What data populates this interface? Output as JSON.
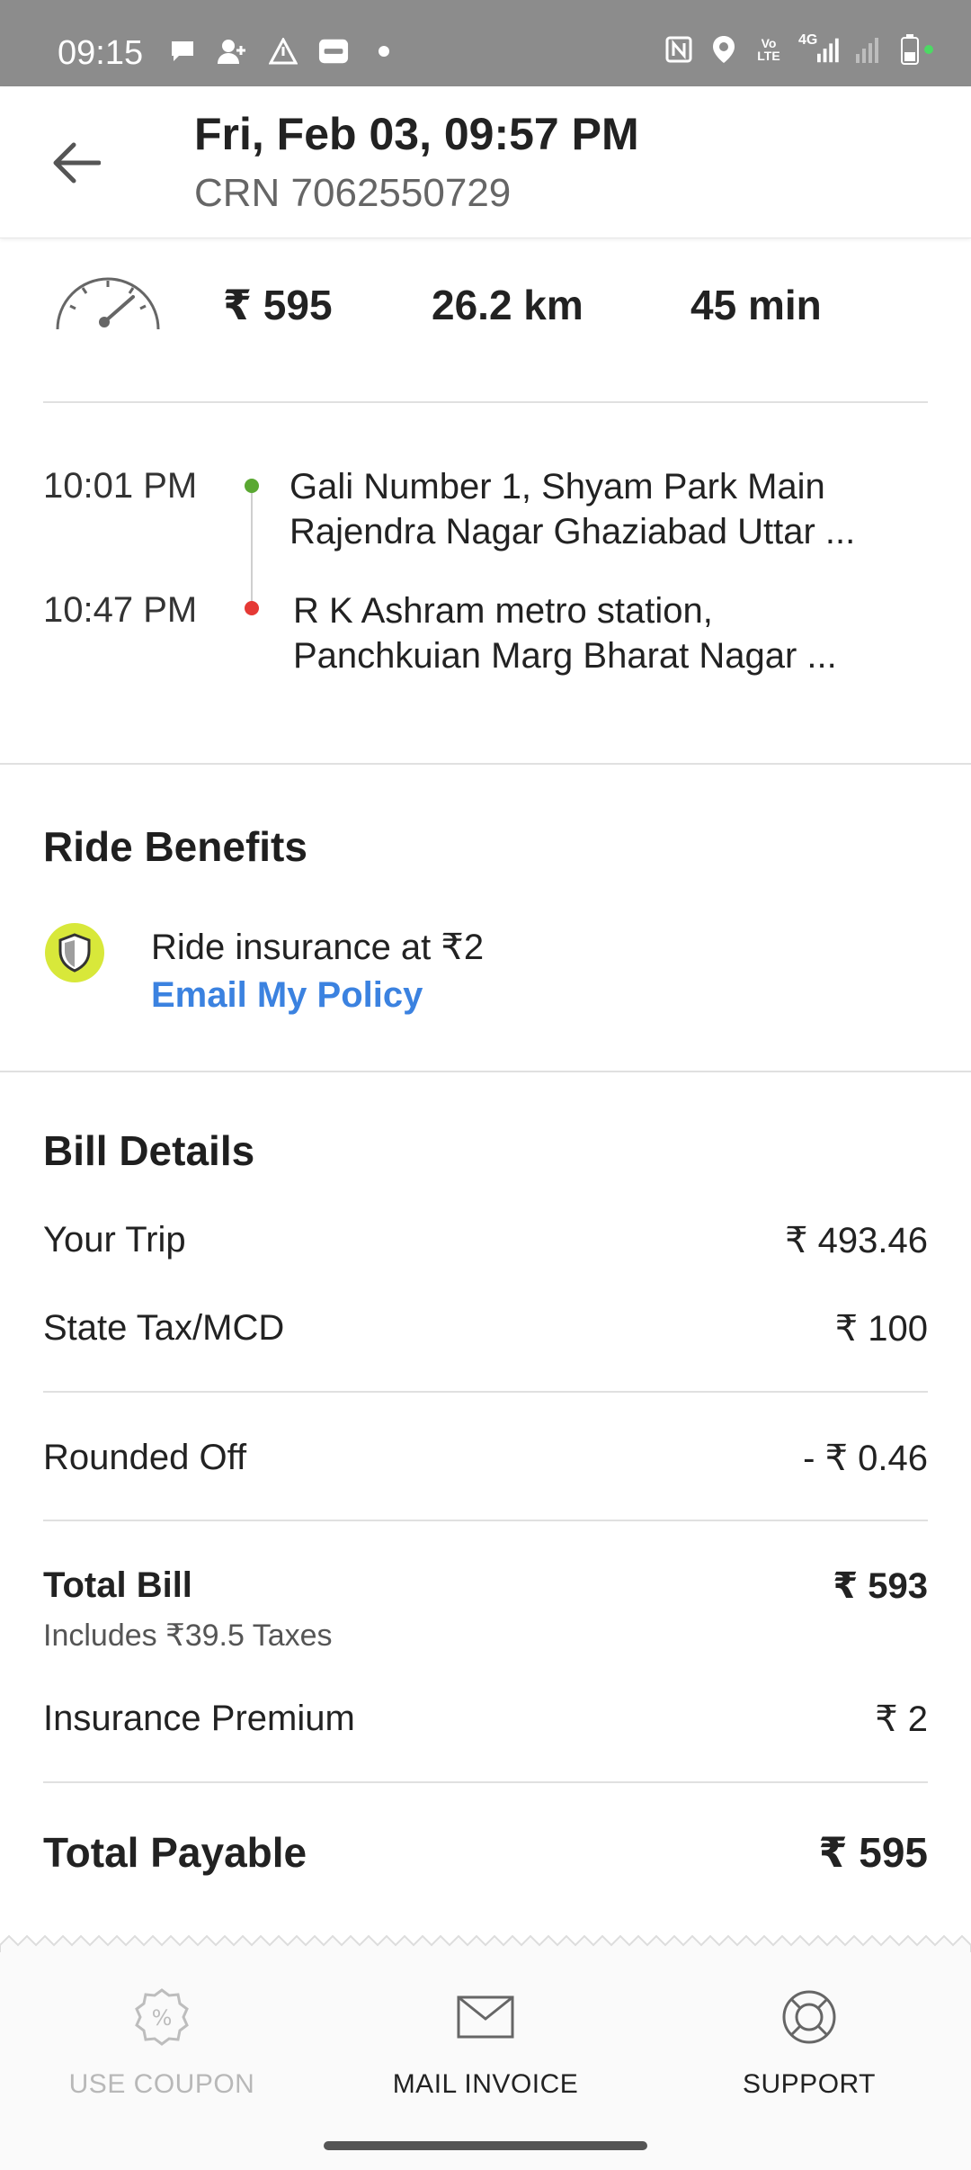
{
  "status_bar": {
    "time": "09:15",
    "network_label": "4G",
    "volte_label": "Vo LTE",
    "left_icons": [
      "chat-bubble-icon",
      "add-person-icon",
      "warning-triangle-icon",
      "paytm-icon",
      "dot-icon"
    ],
    "right_icons": [
      "nfc-icon",
      "location-icon",
      "volte-icon",
      "signal-4g-icon",
      "signal-icon",
      "battery-icon"
    ]
  },
  "header": {
    "title": "Fri, Feb 03, 09:57 PM",
    "crn": "CRN 7062550729",
    "back_icon": "arrow-left-icon"
  },
  "summary": {
    "fare": "₹ 595",
    "distance": "26.2 km",
    "duration": "45 min",
    "icon": "speedometer-icon"
  },
  "route": {
    "pickup": {
      "time": "10:01 PM",
      "address_line1": "Gali Number 1, Shyam Park Main",
      "address_line2": "Rajendra Nagar Ghaziabad Uttar ...",
      "pin_color": "#5aa832"
    },
    "drop": {
      "time": "10:47 PM",
      "address_line1": "R K Ashram metro station,",
      "address_line2": "Panchkuian Marg Bharat Nagar ...",
      "pin_color": "#e53935"
    }
  },
  "ride_benefits": {
    "title": "Ride Benefits",
    "insurance_text": "Ride insurance at ₹2",
    "email_link": "Email My Policy",
    "icon": "shield-icon",
    "accent": "#3b82e0"
  },
  "bill": {
    "title": "Bill Details",
    "rows": [
      {
        "label": "Your Trip",
        "value": "₹ 493.46"
      },
      {
        "label": "State Tax/MCD",
        "value": "₹ 100"
      },
      {
        "label": "Rounded Off",
        "value": "- ₹ 0.46"
      }
    ],
    "total_bill_label": "Total Bill",
    "total_bill_value": "₹ 593",
    "total_bill_note": "Includes ₹39.5 Taxes",
    "insurance_label": "Insurance Premium",
    "insurance_value": "₹ 2",
    "total_payable_label": "Total Payable",
    "total_payable_value": "₹ 595"
  },
  "actions": {
    "coupon_label": "USE COUPON",
    "mail_label": "MAIL INVOICE",
    "support_label": "SUPPORT",
    "coupon_icon": "coupon-icon",
    "mail_icon": "mail-icon",
    "support_icon": "support-lifebuoy-icon"
  }
}
